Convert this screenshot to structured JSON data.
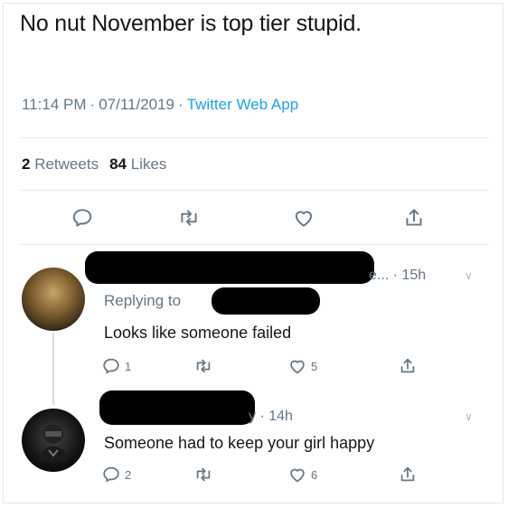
{
  "tweet": {
    "text": "No nut November is top tier stupid.",
    "time": "11:14 PM",
    "date": "07/11/2019",
    "source": "Twitter Web App",
    "separator": "·",
    "retweets_count": "2",
    "retweets_label": "Retweets",
    "likes_count": "84",
    "likes_label": "Likes"
  },
  "replies": [
    {
      "handle_tail": "e... · 15h",
      "replying_to": "Replying to",
      "text": "Looks like someone failed",
      "reply_count": "1",
      "retweet_count": "",
      "like_count": "5"
    },
    {
      "handle_tail": "y · 14h",
      "text": "Someone had to keep your girl happy",
      "reply_count": "2",
      "retweet_count": "",
      "like_count": "6"
    }
  ],
  "icons": {
    "reply": "reply-icon",
    "retweet": "retweet-icon",
    "like": "heart-icon",
    "share": "share-icon",
    "more": "chevron-down-icon"
  },
  "colors": {
    "accent": "#1da1f2",
    "muted": "#657786",
    "text": "#14171a"
  }
}
